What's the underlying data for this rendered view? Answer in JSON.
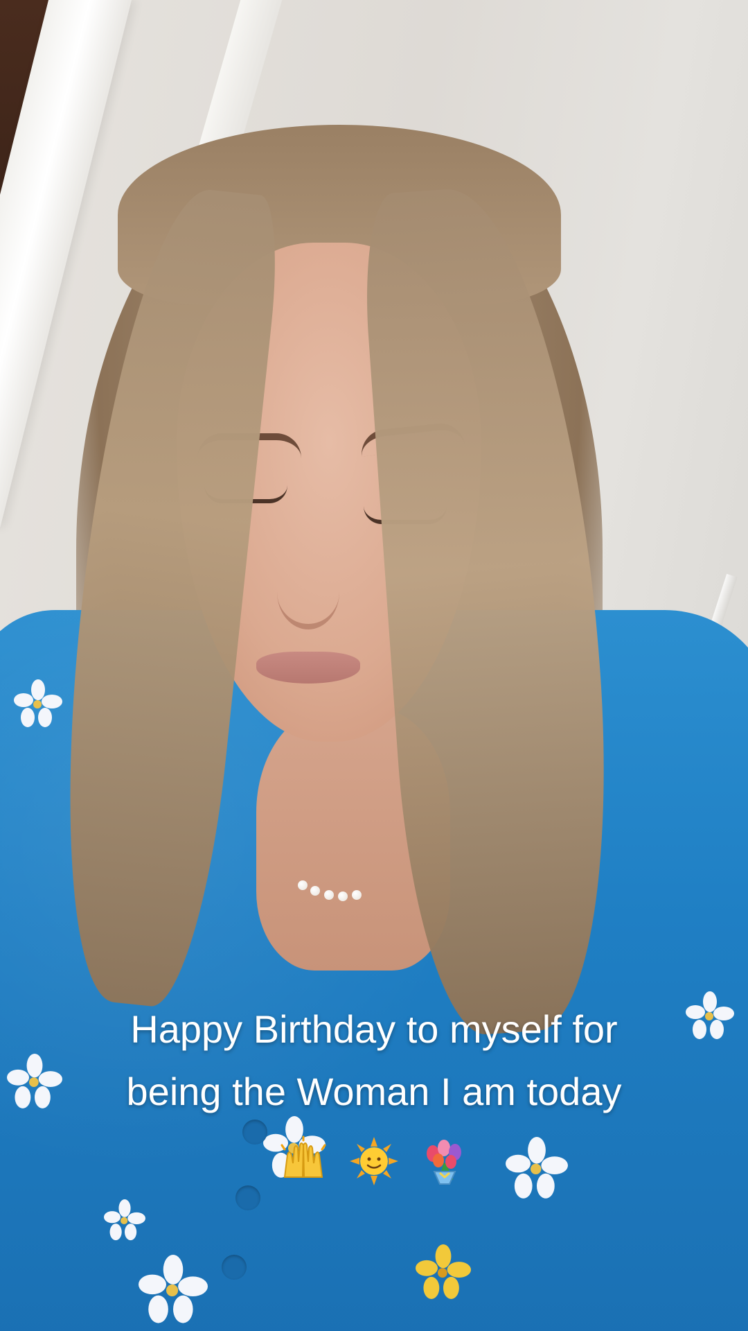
{
  "caption": {
    "line1": "Happy Birthday to myself for",
    "line2": "being the Woman I am today",
    "emojis": [
      "raising-hands-icon",
      "sun-with-face-icon",
      "bouquet-icon"
    ]
  },
  "colors": {
    "blouse": "#1f7fc4",
    "hair": "#a58d72",
    "wall": "#e0ddd8",
    "caption_text": "#ffffff"
  }
}
